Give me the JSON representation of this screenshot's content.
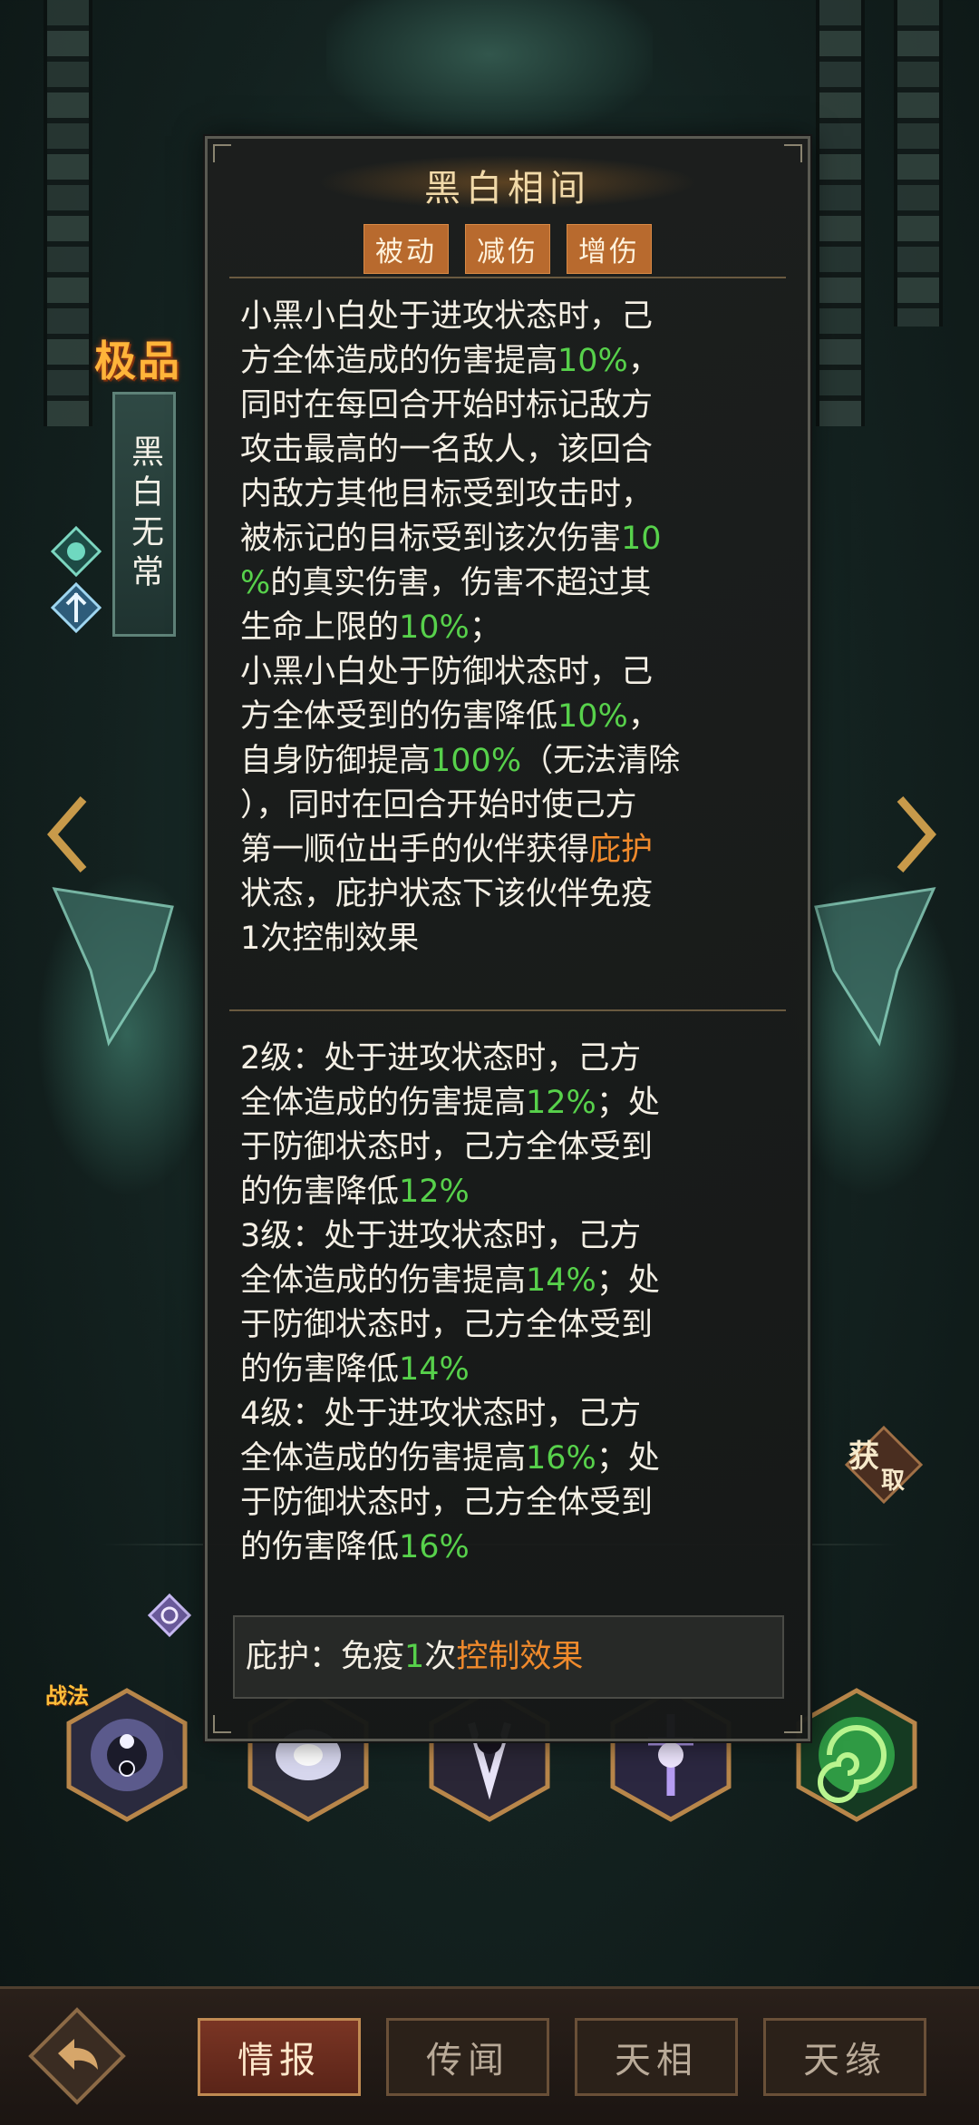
{
  "skill": {
    "title": "黑白相间",
    "tags": [
      "被动",
      "减伤",
      "增伤"
    ],
    "description_lines": [
      [
        {
          "t": "小黑小白处于进攻状态时，己"
        }
      ],
      [
        {
          "t": "方全体造成的伤害提高"
        },
        {
          "t": "10%",
          "c": "g"
        },
        {
          "t": "，"
        }
      ],
      [
        {
          "t": "同时在每回合开始时标记敌方"
        }
      ],
      [
        {
          "t": "攻击最高的一名敌人，该回合"
        }
      ],
      [
        {
          "t": "内敌方其他目标受到攻击时，"
        }
      ],
      [
        {
          "t": "被标记的目标受到该次伤害"
        },
        {
          "t": "10",
          "c": "g"
        }
      ],
      [
        {
          "t": "%",
          "c": "g"
        },
        {
          "t": "的真实伤害，伤害不超过其"
        }
      ],
      [
        {
          "t": "生命上限的"
        },
        {
          "t": "10%",
          "c": "g"
        },
        {
          "t": "；"
        }
      ],
      [
        {
          "t": "小黑小白处于防御状态时，己"
        }
      ],
      [
        {
          "t": "方全体受到的伤害降低"
        },
        {
          "t": "10%",
          "c": "g"
        },
        {
          "t": "，"
        }
      ],
      [
        {
          "t": "自身防御提高"
        },
        {
          "t": "100%",
          "c": "g"
        },
        {
          "t": "（无法清除"
        }
      ],
      [
        {
          "t": "），同时在回合开始时使己方"
        }
      ],
      [
        {
          "t": "第一顺位出手的伙伴获得"
        },
        {
          "t": "庇护",
          "c": "o"
        }
      ],
      [
        {
          "t": "状态，庇护状态下该伙伴免疫"
        }
      ],
      [
        {
          "t": "1次控制效果"
        }
      ]
    ],
    "level_lines": [
      [
        {
          "t": "2级：处于进攻状态时，己方"
        }
      ],
      [
        {
          "t": "全体造成的伤害提高"
        },
        {
          "t": "12%",
          "c": "g"
        },
        {
          "t": "；处"
        }
      ],
      [
        {
          "t": "于防御状态时，己方全体受到"
        }
      ],
      [
        {
          "t": "的伤害降低"
        },
        {
          "t": "12%",
          "c": "g"
        }
      ],
      [
        {
          "t": "3级：处于进攻状态时，己方"
        }
      ],
      [
        {
          "t": "全体造成的伤害提高"
        },
        {
          "t": "14%",
          "c": "g"
        },
        {
          "t": "；处"
        }
      ],
      [
        {
          "t": "于防御状态时，己方全体受到"
        }
      ],
      [
        {
          "t": "的伤害降低"
        },
        {
          "t": "14%",
          "c": "g"
        }
      ],
      [
        {
          "t": "4级：处于进攻状态时，己方"
        }
      ],
      [
        {
          "t": "全体造成的伤害提高"
        },
        {
          "t": "16%",
          "c": "g"
        },
        {
          "t": "；处"
        }
      ],
      [
        {
          "t": "于防御状态时，己方全体受到"
        }
      ],
      [
        {
          "t": "的伤害降低"
        },
        {
          "t": "16%",
          "c": "g"
        }
      ]
    ],
    "note": [
      {
        "t": "庇护：免疫"
      },
      {
        "t": "1",
        "c": "g"
      },
      {
        "t": "次"
      },
      {
        "t": "控制效果",
        "c": "o"
      }
    ]
  },
  "character": {
    "rarity": "极品",
    "name": "黑白无常"
  },
  "get_badge": {
    "line1": "获",
    "line2": "取"
  },
  "war_method_label": "战法",
  "tabs": [
    "情报",
    "传闻",
    "天相",
    "天缘"
  ],
  "active_tab": "情报",
  "colors": {
    "highlight_green": "#57d14b",
    "highlight_orange": "#f08a2c",
    "tag_bg": "#b86a2e",
    "rarity_gold": "#ffb43a"
  }
}
